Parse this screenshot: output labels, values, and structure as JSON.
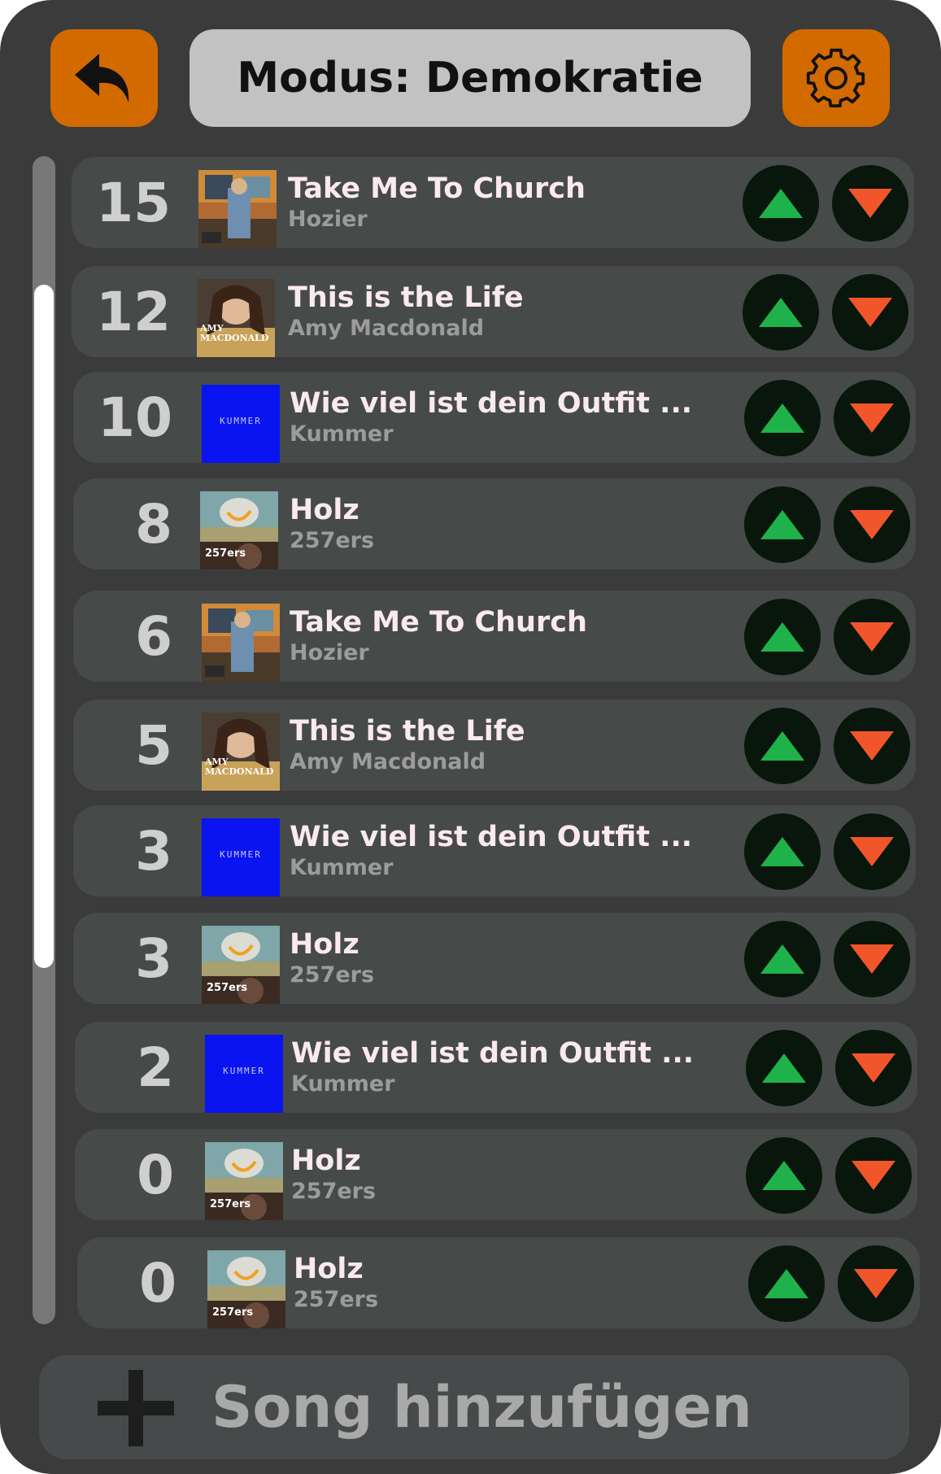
{
  "header": {
    "title": "Modus: Demokratie",
    "back_icon": "undo-arrow-icon",
    "settings_icon": "gear-icon"
  },
  "colors": {
    "background": "#3b3b3b",
    "accent": "#d26a00",
    "row": "#464a48",
    "upvote": "#1fb24a",
    "downvote": "#f0562a",
    "vote_button": "#08160c"
  },
  "songs": [
    {
      "votes": "15",
      "title": "Take Me To Church",
      "artist": "Hozier",
      "cover": "hozier"
    },
    {
      "votes": "12",
      "title": "This is the Life",
      "artist": "Amy Macdonald",
      "cover": "amy"
    },
    {
      "votes": "10",
      "title": "Wie viel ist dein Outfit ...",
      "artist": "Kummer",
      "cover": "kummer"
    },
    {
      "votes": "8",
      "title": "Holz",
      "artist": "257ers",
      "cover": "257ers"
    },
    {
      "votes": "6",
      "title": "Take Me To Church",
      "artist": "Hozier",
      "cover": "hozier"
    },
    {
      "votes": "5",
      "title": "This is the Life",
      "artist": "Amy Macdonald",
      "cover": "amy"
    },
    {
      "votes": "3",
      "title": "Wie viel ist dein Outfit ...",
      "artist": "Kummer",
      "cover": "kummer"
    },
    {
      "votes": "3",
      "title": "Holz",
      "artist": "257ers",
      "cover": "257ers"
    },
    {
      "votes": "2",
      "title": "Wie viel ist dein Outfit ...",
      "artist": "Kummer",
      "cover": "kummer"
    },
    {
      "votes": "0",
      "title": "Holz",
      "artist": "257ers",
      "cover": "257ers"
    },
    {
      "votes": "0",
      "title": "Holz",
      "artist": "257ers",
      "cover": "257ers"
    }
  ],
  "cover_text": {
    "amy": "AMY MACDONALD",
    "kummer": "KUMMER",
    "257ers": "257ers"
  },
  "add_song": {
    "label": "Song hinzufügen",
    "icon": "plus-icon"
  }
}
